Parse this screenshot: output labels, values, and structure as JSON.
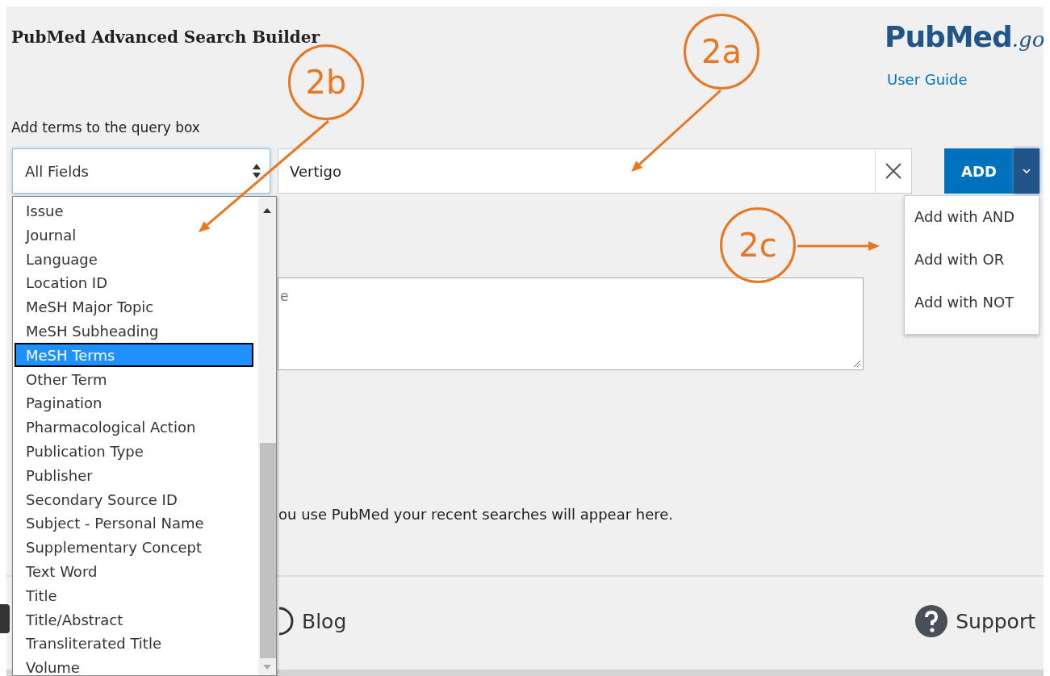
{
  "header": {
    "title": "PubMed Advanced Search Builder",
    "logo": {
      "part_1": "Pub",
      "part_2": "Med",
      "suffix": ".go"
    },
    "user_guide_link": "User Guide"
  },
  "search_builder": {
    "label": "Add terms to the query box",
    "field_select": {
      "value": "All Fields",
      "expanded": true
    },
    "term_input": {
      "value": "Vertigo"
    },
    "add_button": {
      "label": "ADD"
    },
    "add_menu": {
      "expanded": true,
      "items": [
        {
          "label": "Add with AND"
        },
        {
          "label": "Add with OR"
        },
        {
          "label": "Add with NOT"
        }
      ]
    }
  },
  "field_options": [
    {
      "label": "Issue",
      "selected": false
    },
    {
      "label": "Journal",
      "selected": false
    },
    {
      "label": "Language",
      "selected": false
    },
    {
      "label": "Location ID",
      "selected": false
    },
    {
      "label": "MeSH Major Topic",
      "selected": false
    },
    {
      "label": "MeSH Subheading",
      "selected": false
    },
    {
      "label": "MeSH Terms",
      "selected": true
    },
    {
      "label": "Other Term",
      "selected": false
    },
    {
      "label": "Pagination",
      "selected": false
    },
    {
      "label": "Pharmacological Action",
      "selected": false
    },
    {
      "label": "Publication Type",
      "selected": false
    },
    {
      "label": "Publisher",
      "selected": false
    },
    {
      "label": "Secondary Source ID",
      "selected": false
    },
    {
      "label": "Subject - Personal Name",
      "selected": false
    },
    {
      "label": "Supplementary Concept",
      "selected": false
    },
    {
      "label": "Text Word",
      "selected": false
    },
    {
      "label": "Title",
      "selected": false
    },
    {
      "label": "Title/Abstract",
      "selected": false
    },
    {
      "label": "Transliterated Title",
      "selected": false
    },
    {
      "label": "Volume",
      "selected": false
    }
  ],
  "query_box": {
    "placeholder": "e"
  },
  "history": {
    "text": "ou use PubMed your recent searches will appear here."
  },
  "footer": {
    "links": [
      {
        "kind": "blog",
        "label": "Blog"
      },
      {
        "kind": "support",
        "label": "Support"
      }
    ]
  },
  "callouts": [
    {
      "label": "2a"
    },
    {
      "label": "2b"
    },
    {
      "label": "2c"
    }
  ]
}
